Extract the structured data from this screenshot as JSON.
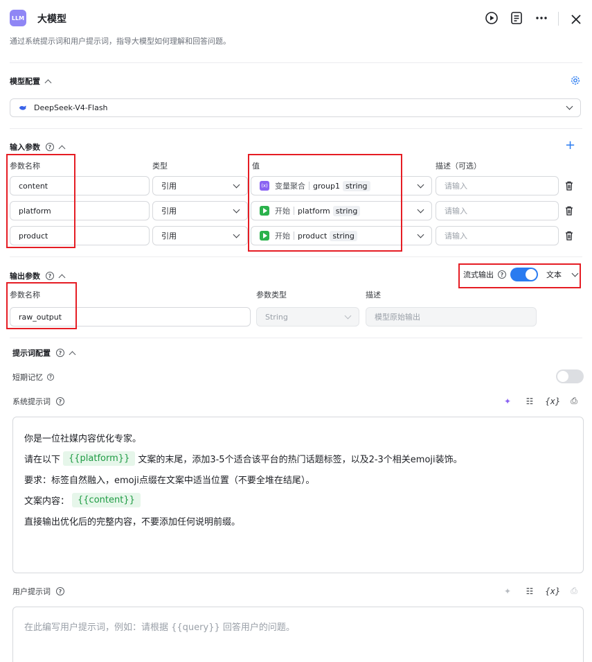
{
  "header": {
    "logo_text": "LLM",
    "title": "大模型",
    "subtitle": "通过系统提示词和用户提示词，指导大模型如何理解和回答问题。",
    "icons": [
      "play-icon",
      "notes-icon",
      "more-icon",
      "close-icon"
    ]
  },
  "model_config": {
    "title": "模型配置",
    "model_name": "DeepSeek-V4-Flash"
  },
  "input_params": {
    "title": "输入参数",
    "col_name": "参数名称",
    "col_type": "类型",
    "col_value": "值",
    "col_desc": "描述（可选）",
    "desc_placeholder": "请输入",
    "rows": [
      {
        "name": "content",
        "type": "引用",
        "source": "变量聚合",
        "var": "group1",
        "dtype": "string"
      },
      {
        "name": "platform",
        "type": "引用",
        "source": "开始",
        "var": "platform",
        "dtype": "string"
      },
      {
        "name": "product",
        "type": "引用",
        "source": "开始",
        "var": "product",
        "dtype": "string"
      }
    ]
  },
  "output_params": {
    "title": "输出参数",
    "stream_label": "流式输出",
    "format": "文本",
    "col_name": "参数名称",
    "col_type": "参数类型",
    "col_desc": "描述",
    "name": "raw_output",
    "type": "String",
    "desc": "模型原始输出"
  },
  "prompt_config": {
    "title": "提示词配置",
    "short_memory": "短期记忆",
    "system_prompt_label": "系统提示词",
    "system_lines": {
      "l1": "你是一位社媒内容优化专家。",
      "l2_a": "请在以下",
      "l2_var": "{{platform}}",
      "l2_b": "文案的末尾，添加3-5个适合该平台的热门话题标签，以及2-3个相关emoji装饰。",
      "l3": "要求：标签自然融入，emoji点缀在文案中适当位置（不要全堆在结尾）。",
      "l4_a": "文案内容：",
      "l4_var": "{{content}}",
      "l5": "直接输出优化后的完整内容，不要添加任何说明前缀。"
    },
    "user_prompt_label": "用户提示词",
    "user_placeholder": "在此编写用户提示词，例如：请根据 {{query}} 回答用户的问题。",
    "var_icon_text": "{x}"
  },
  "colors": {
    "accent": "#2a7bf0",
    "highlight": "#e51c23",
    "var_bg": "#e6f6ea"
  }
}
